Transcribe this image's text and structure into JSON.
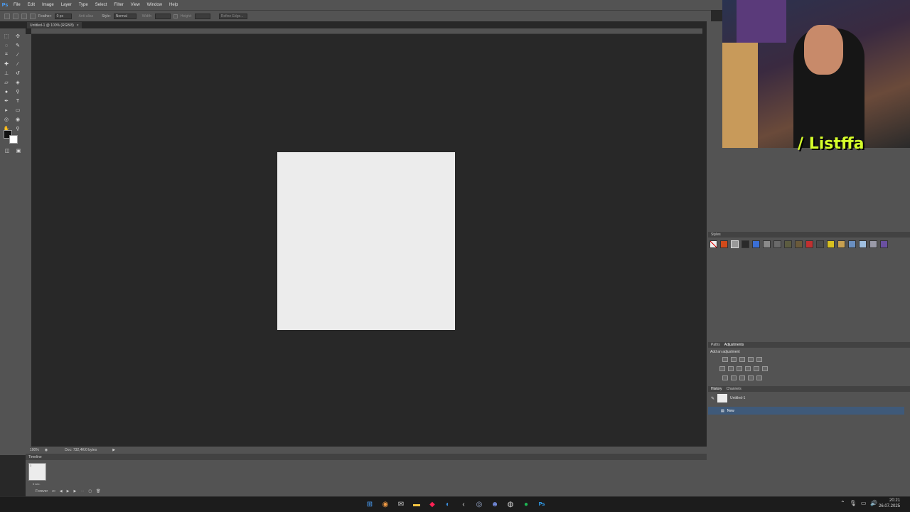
{
  "app": {
    "logo": "Ps"
  },
  "menu": [
    "File",
    "Edit",
    "Image",
    "Layer",
    "Type",
    "Select",
    "Filter",
    "View",
    "Window",
    "Help"
  ],
  "options": {
    "feather_label": "Feather:",
    "feather_value": "0 px",
    "anti_alias": "Anti-alias",
    "style_label": "Style:",
    "style_value": "Normal",
    "width_label": "Width:",
    "height_label": "Height:",
    "refine_edge": "Refine Edge..."
  },
  "document": {
    "tab_title": "Untitled-1 @ 100% (RGB/8)",
    "close": "×"
  },
  "status": {
    "zoom": "100%",
    "doc": "Doc: 732,4K/0 bytes"
  },
  "timeline": {
    "title": "Timeline",
    "frame_number": "1",
    "frame_delay": "0 sec.",
    "loop": "Forever"
  },
  "panels": {
    "styles_title": "Styles",
    "paths_tab": "Paths",
    "adjustments_tab": "Adjustments",
    "add_adjustment": "Add an adjustment",
    "history_tab": "History",
    "channels_tab": "Channels",
    "history_items": [
      "Untitled-1",
      "New"
    ]
  },
  "webcam": {
    "name": "/ Listffa"
  },
  "clock": {
    "time": "20:21",
    "date": "26.07.2025"
  },
  "colors": {
    "accent": "#4aa3ff",
    "history_selected": "#3f5a7a"
  }
}
